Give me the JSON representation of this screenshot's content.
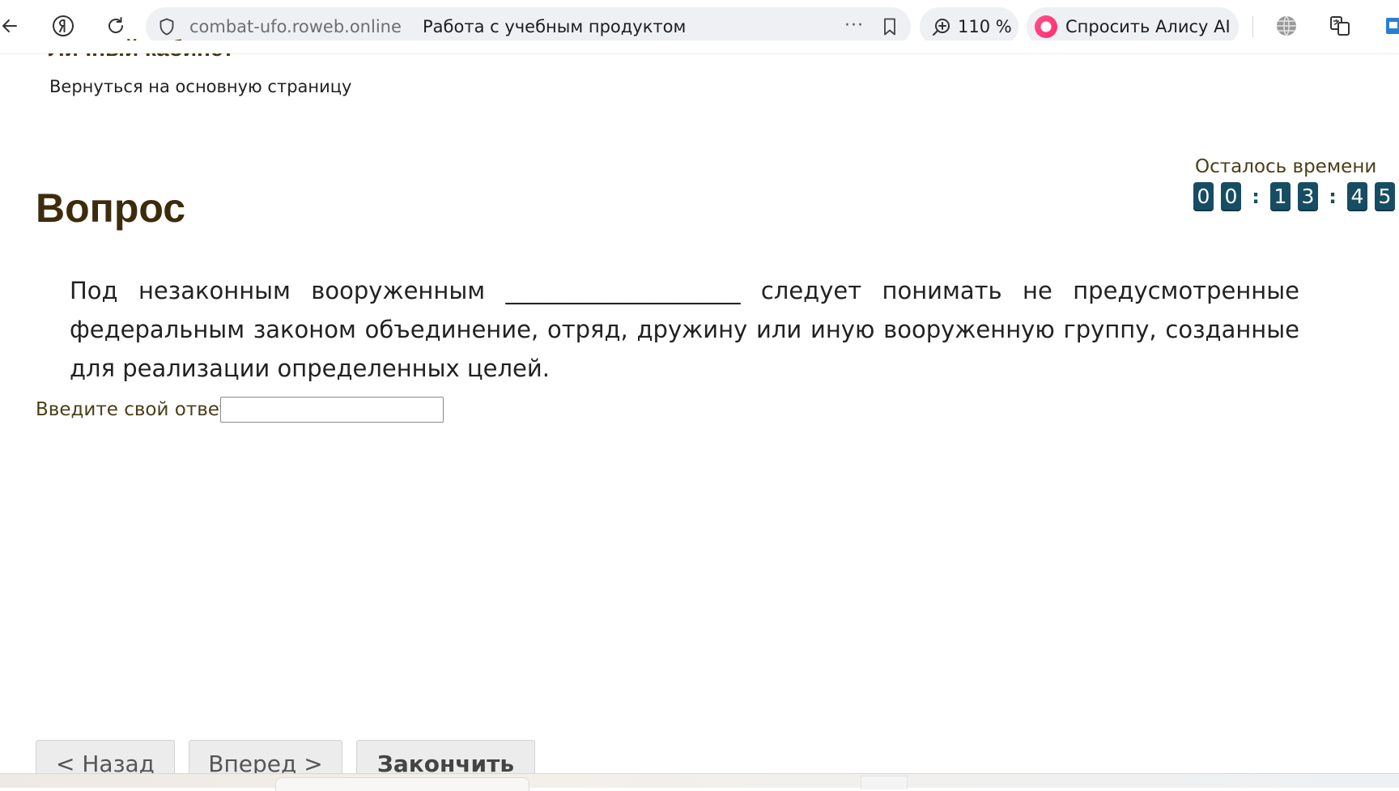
{
  "browser": {
    "domain": "combat-ufo.roweb.online",
    "page_title": "Работа с учебным продуктом",
    "more_label": "···",
    "zoom": "110 %",
    "alice_label": "Спросить Алису AI"
  },
  "page": {
    "cabinet_title": "Личный кабинет",
    "back_link": "Вернуться на основную страницу",
    "question_heading": "Вопрос",
    "timer": {
      "label": "Осталось времени",
      "digits": [
        "0",
        "0",
        "1",
        "3",
        "4",
        "5"
      ]
    },
    "question_text": "Под незаконным вооруженным ____________________ следует понимать не предусмотренные федеральным законом объединение, отряд, дружину или иную вооруженную группу, созданные для реализации определенных целей.",
    "answer_label": "Введите свой ответ",
    "answer_value": "",
    "buttons": {
      "back": "< Назад",
      "forward": "Вперед >",
      "finish": "Закончить"
    }
  }
}
